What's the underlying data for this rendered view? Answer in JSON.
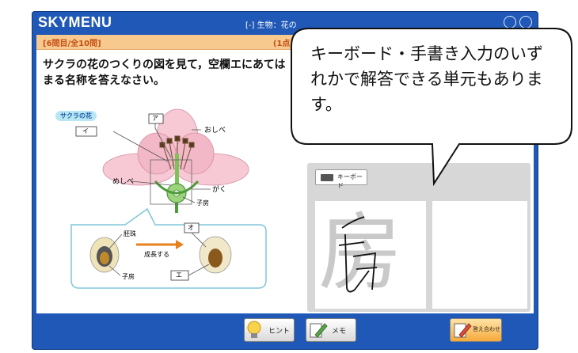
{
  "app": {
    "logo": "SKYMENU",
    "breadcrumb": "[-] 生物：花の"
  },
  "question": {
    "number": "[6問目/全10問]",
    "points": "(1点)",
    "text": "サクラの花のつくりの図を見て，空欄エにあてはまる名称を答えなさい。"
  },
  "figure": {
    "tag": "サクラの花",
    "labels": {
      "a": "ア",
      "i": "イ",
      "e": "エ",
      "o": "オ",
      "oshibe": "おしべ",
      "meshibe": "めしべ",
      "gaku": "がく",
      "shibou": "子房",
      "haishu": "胚珠",
      "seichou": "成長する",
      "shibou2": "子房"
    }
  },
  "input": {
    "keyboard_label": "キーボード",
    "ghost_char": "房"
  },
  "bubble": {
    "text": "キーボード・手書き入力のいずれかで解答できる単元もあります。"
  },
  "bottom": {
    "hint": "ヒント",
    "memo": "メモ",
    "match": "答え合わせ"
  }
}
